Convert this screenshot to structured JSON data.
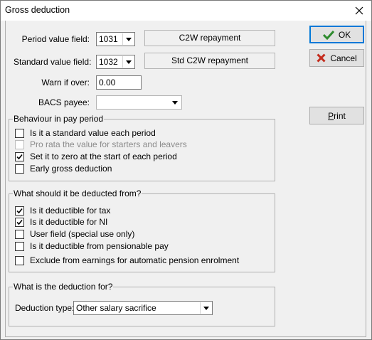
{
  "window": {
    "title": "Gross deduction"
  },
  "fields": {
    "period_value": {
      "label": "Period value field:",
      "value": "1031",
      "desc": "C2W repayment"
    },
    "standard_value": {
      "label": "Standard value field:",
      "value": "1032",
      "desc": "Std C2W repayment"
    },
    "warn_if_over": {
      "label": "Warn if over:",
      "value": "0.00"
    },
    "bacs_payee": {
      "label": "BACS payee:",
      "value": ""
    }
  },
  "buttons": {
    "ok": "OK",
    "cancel": "Cancel",
    "print_p": "P",
    "print_rest": "rint"
  },
  "behaviour": {
    "legend": "Behaviour in pay period",
    "items": [
      {
        "label": "Is it a standard value each period",
        "checked": false,
        "disabled": false
      },
      {
        "label": "Pro rata the value for starters and leavers",
        "checked": false,
        "disabled": true
      },
      {
        "label": "Set it to zero at the start of each period",
        "checked": true,
        "disabled": false
      },
      {
        "label": "Early gross deduction",
        "checked": false,
        "disabled": false
      }
    ]
  },
  "deducted_from": {
    "legend": "What should it be deducted from?",
    "items": [
      {
        "label": "Is it deductible for tax",
        "checked": true
      },
      {
        "label": "Is it deductible for NI",
        "checked": true
      },
      {
        "label": "User field (special use only)",
        "checked": false
      },
      {
        "label": "Is it deductible from pensionable pay",
        "checked": false
      },
      {
        "label": "Exclude from earnings for automatic pension enrolment",
        "checked": false
      }
    ]
  },
  "deduction_for": {
    "legend": "What is the deduction for?",
    "type_label": "Deduction type:",
    "type_value": "Other salary sacrifice"
  },
  "colors": {
    "ok_icon": "#2e8b2e",
    "cancel_icon": "#c42b1c",
    "default_border": "#0078d7"
  }
}
